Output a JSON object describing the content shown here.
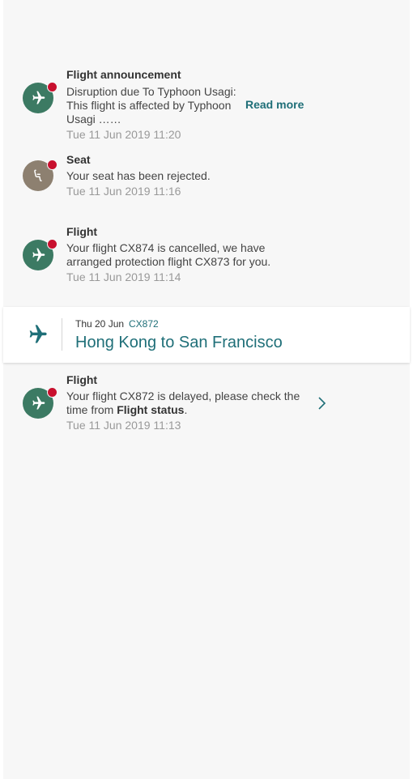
{
  "notifications": [
    {
      "title": "Flight announcement",
      "body": "Disruption due To Typhoon Usagi: This flight is affected by Typhoon Usagi ……",
      "read_more": "Read more",
      "time": "Tue 11 Jun 2019 11:20"
    },
    {
      "title": "Seat",
      "body": "Your seat has been rejected.",
      "time": "Tue 11 Jun 2019 11:16"
    },
    {
      "title": "Flight",
      "body": "Your flight CX874 is cancelled, we have arranged protection flight CX873 for you.",
      "time": "Tue 11 Jun 2019 11:14"
    },
    {
      "title": "Flight",
      "body_prefix": "Your flight CX872 is delayed, please check the time from ",
      "body_link": "Flight status",
      "body_suffix": ".",
      "time": "Tue 11 Jun 2019 11:13"
    }
  ],
  "flight_card": {
    "date": "Thu 20 Jun",
    "flight_number": "CX872",
    "route": "Hong Kong to San Francisco"
  },
  "colors": {
    "accent": "#1f6f78",
    "flight_icon_bg": "#3c7a63",
    "seat_icon_bg": "#8d8070",
    "unread_dot": "#c8102e"
  }
}
